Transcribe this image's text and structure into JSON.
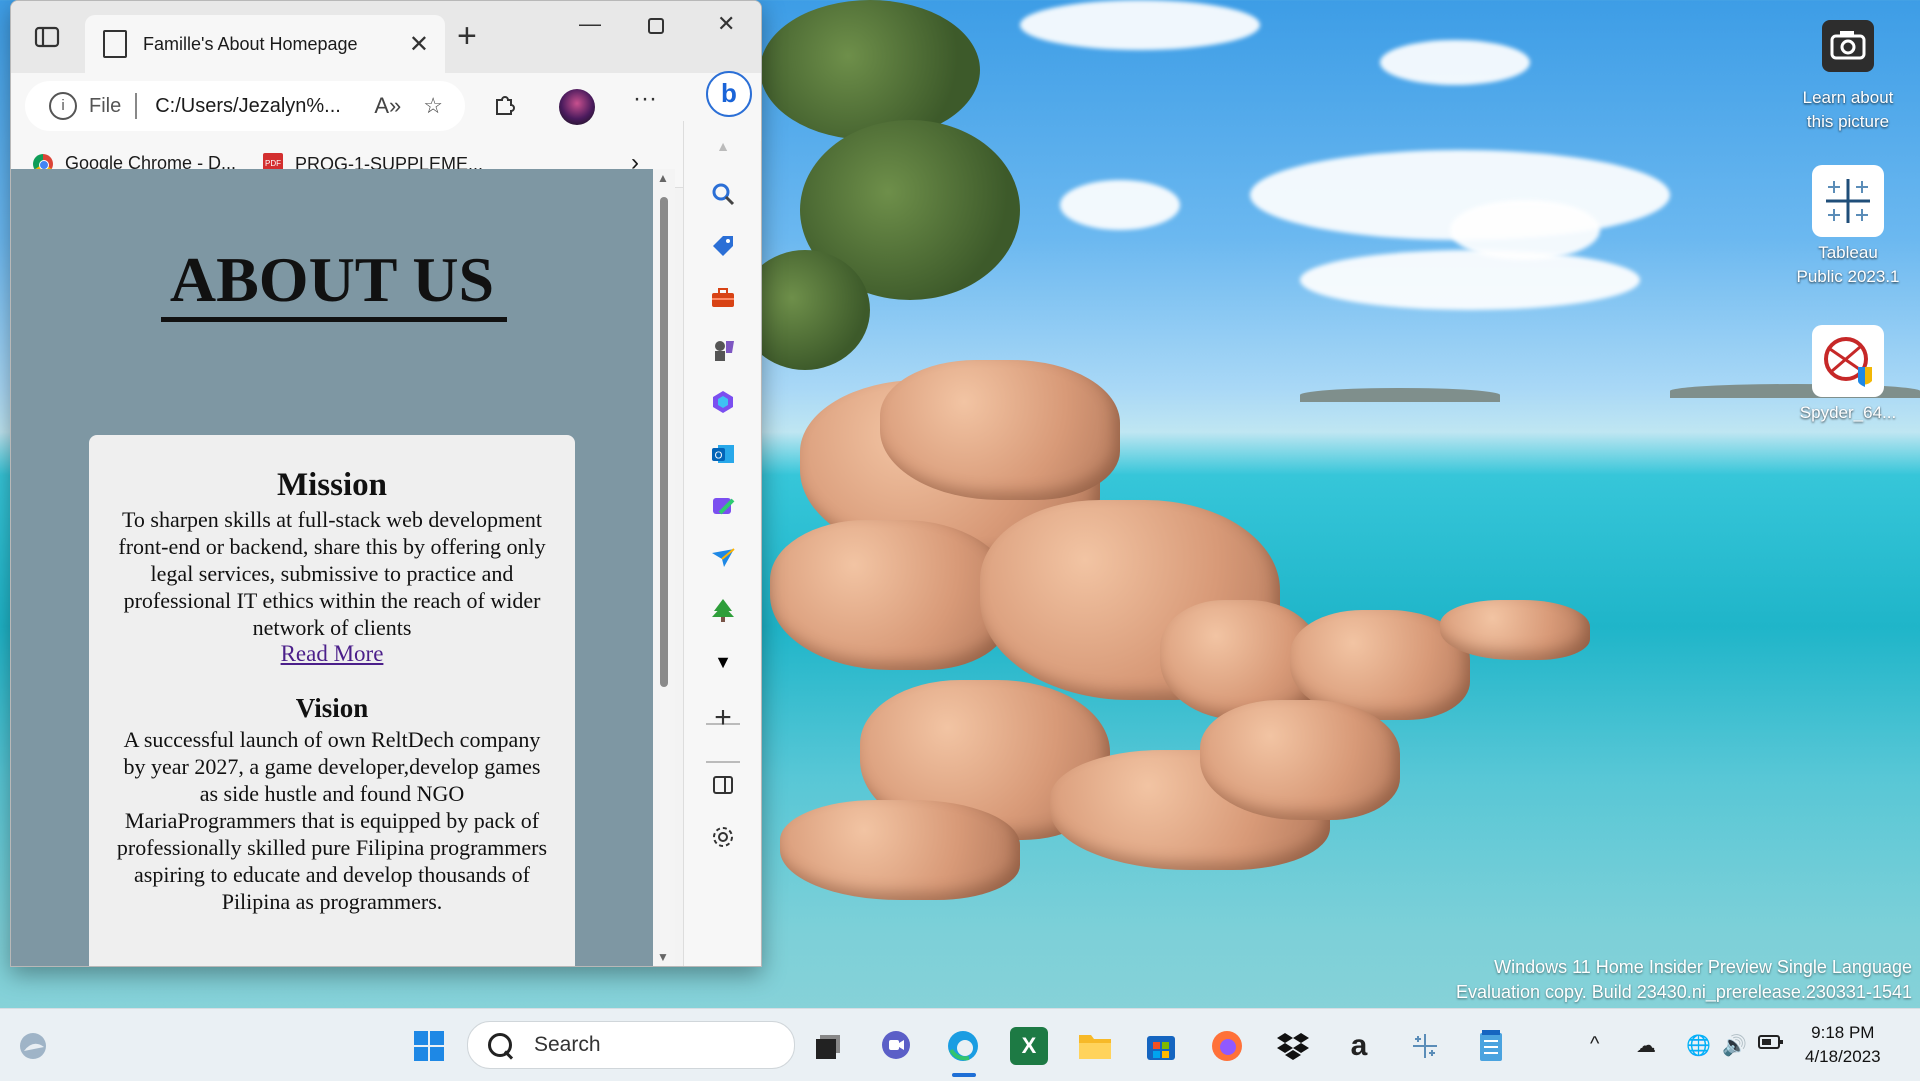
{
  "browser": {
    "tab_title": "Famille's About Homepage",
    "address_scheme": "File",
    "address_url": "C:/Users/Jezalyn%...",
    "bookmarks": [
      {
        "label": "Google Chrome - D...",
        "icon": "chrome-icon"
      },
      {
        "label": "PROG-1-SUPPLEME...",
        "icon": "pdf-icon"
      }
    ]
  },
  "page": {
    "heading": "ABOUT US",
    "mission_title": "Mission",
    "mission_text": "To sharpen skills at full-stack web development front-end or backend, share this by offering only legal services, submissive to practice and professional IT ethics within the reach of wider network of clients",
    "read_more": "Read More",
    "vision_title": "Vision",
    "vision_text": "A successful launch of own ReltDech company by year 2027, a game developer,develop games as side hustle and found NGO MariaProgrammers that is equipped by pack of professionally skilled pure Filipina programmers aspiring to educate and develop thousands of Pilipina as programmers."
  },
  "desktop": {
    "icons": [
      {
        "label": "Learn about this picture",
        "icon": "camera-icon"
      },
      {
        "label": "Tableau Public 2023.1",
        "icon": "tableau-icon"
      },
      {
        "label": "Spyder_64...",
        "icon": "spyder-icon"
      }
    ],
    "watermark_line1": "Windows 11 Home Insider Preview Single Language",
    "watermark_line2": "Evaluation copy. Build 23430.ni_prerelease.230331-1541"
  },
  "taskbar": {
    "search_placeholder": "Search",
    "time": "9:18 PM",
    "date": "4/18/2023"
  },
  "colors": {
    "page_background": "#7e97a3",
    "card_background": "#efefef",
    "link": "#4b1f8a",
    "bing_accent": "#2b6fd6"
  }
}
